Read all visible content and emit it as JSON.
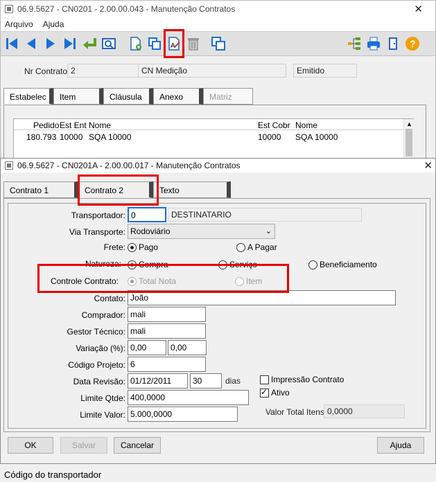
{
  "back_window": {
    "title": "06.9.5627 - CN0201 - 2.00.00.043 - Manutenção Contratos",
    "close": "✕",
    "menu": [
      "Arquivo",
      "Ajuda"
    ],
    "nr_contrato_label": "Nr Contrato:",
    "nr_contrato_value": "2",
    "field_cn_medicao": "CN Medição",
    "field_emitido": "Emitido",
    "tabs": [
      "Estabelec",
      "Item",
      "Cláusula",
      "Anexo",
      "Matriz"
    ],
    "grid": {
      "headers": [
        "Pedido",
        "Est Ent",
        "Nome",
        "Est Cobr",
        "Nome"
      ],
      "row": [
        "180.793",
        "10000",
        "SQA 10000",
        "10000",
        "SQA 10000"
      ]
    }
  },
  "dialog": {
    "title": "06.9.5627 - CN0201A - 2.00.00.017 - Manutenção Contratos",
    "close": "✕",
    "tabs": [
      "Contrato 1",
      "Contrato 2",
      "Texto"
    ],
    "transportador_label": "Transportador:",
    "transportador_value": "0",
    "transportador_name": "DESTINATARIO",
    "via_label": "Via Transporte:",
    "via_value": "Rodoviário",
    "frete_label": "Frete:",
    "frete_pago": "Pago",
    "frete_apagar": "A Pagar",
    "natureza_label": "Natureza:",
    "natureza_compra": "Compra",
    "natureza_servico": "Serviço",
    "natureza_benef": "Beneficiamento",
    "controle_label": "Controle Contrato:",
    "controle_total": "Total Nota",
    "controle_item": "Item",
    "contato_label": "Contato:",
    "contato_value": "João",
    "comprador_label": "Comprador:",
    "comprador_value": "mali",
    "gestor_label": "Gestor Técnico:",
    "gestor_value": "mali",
    "variacao_label": "Variação (%):",
    "variacao_1": "0,00",
    "variacao_2": "0,00",
    "codigo_label": "Código Projeto:",
    "codigo_value": "6",
    "data_label": "Data Revisão:",
    "data_value": "01/12/2011",
    "dias_value": "30",
    "dias_label": "dias",
    "impressao_label": "Impressão Contrato",
    "ativo_label": "Ativo",
    "limite_qtde_label": "Limite Qtde:",
    "limite_qtde_value": "400,0000",
    "limite_valor_label": "Limite Valor:",
    "limite_valor_value": "5.000,0000",
    "valor_total_label": "Valor Total Itens:",
    "valor_total_value": "0,0000",
    "btn_ok": "OK",
    "btn_salvar": "Salvar",
    "btn_cancelar": "Cancelar",
    "btn_ajuda": "Ajuda"
  },
  "status": "Código do transportador",
  "colors": {
    "highlight": "#e60000",
    "toolbar_blue": "#1a6fd6"
  }
}
